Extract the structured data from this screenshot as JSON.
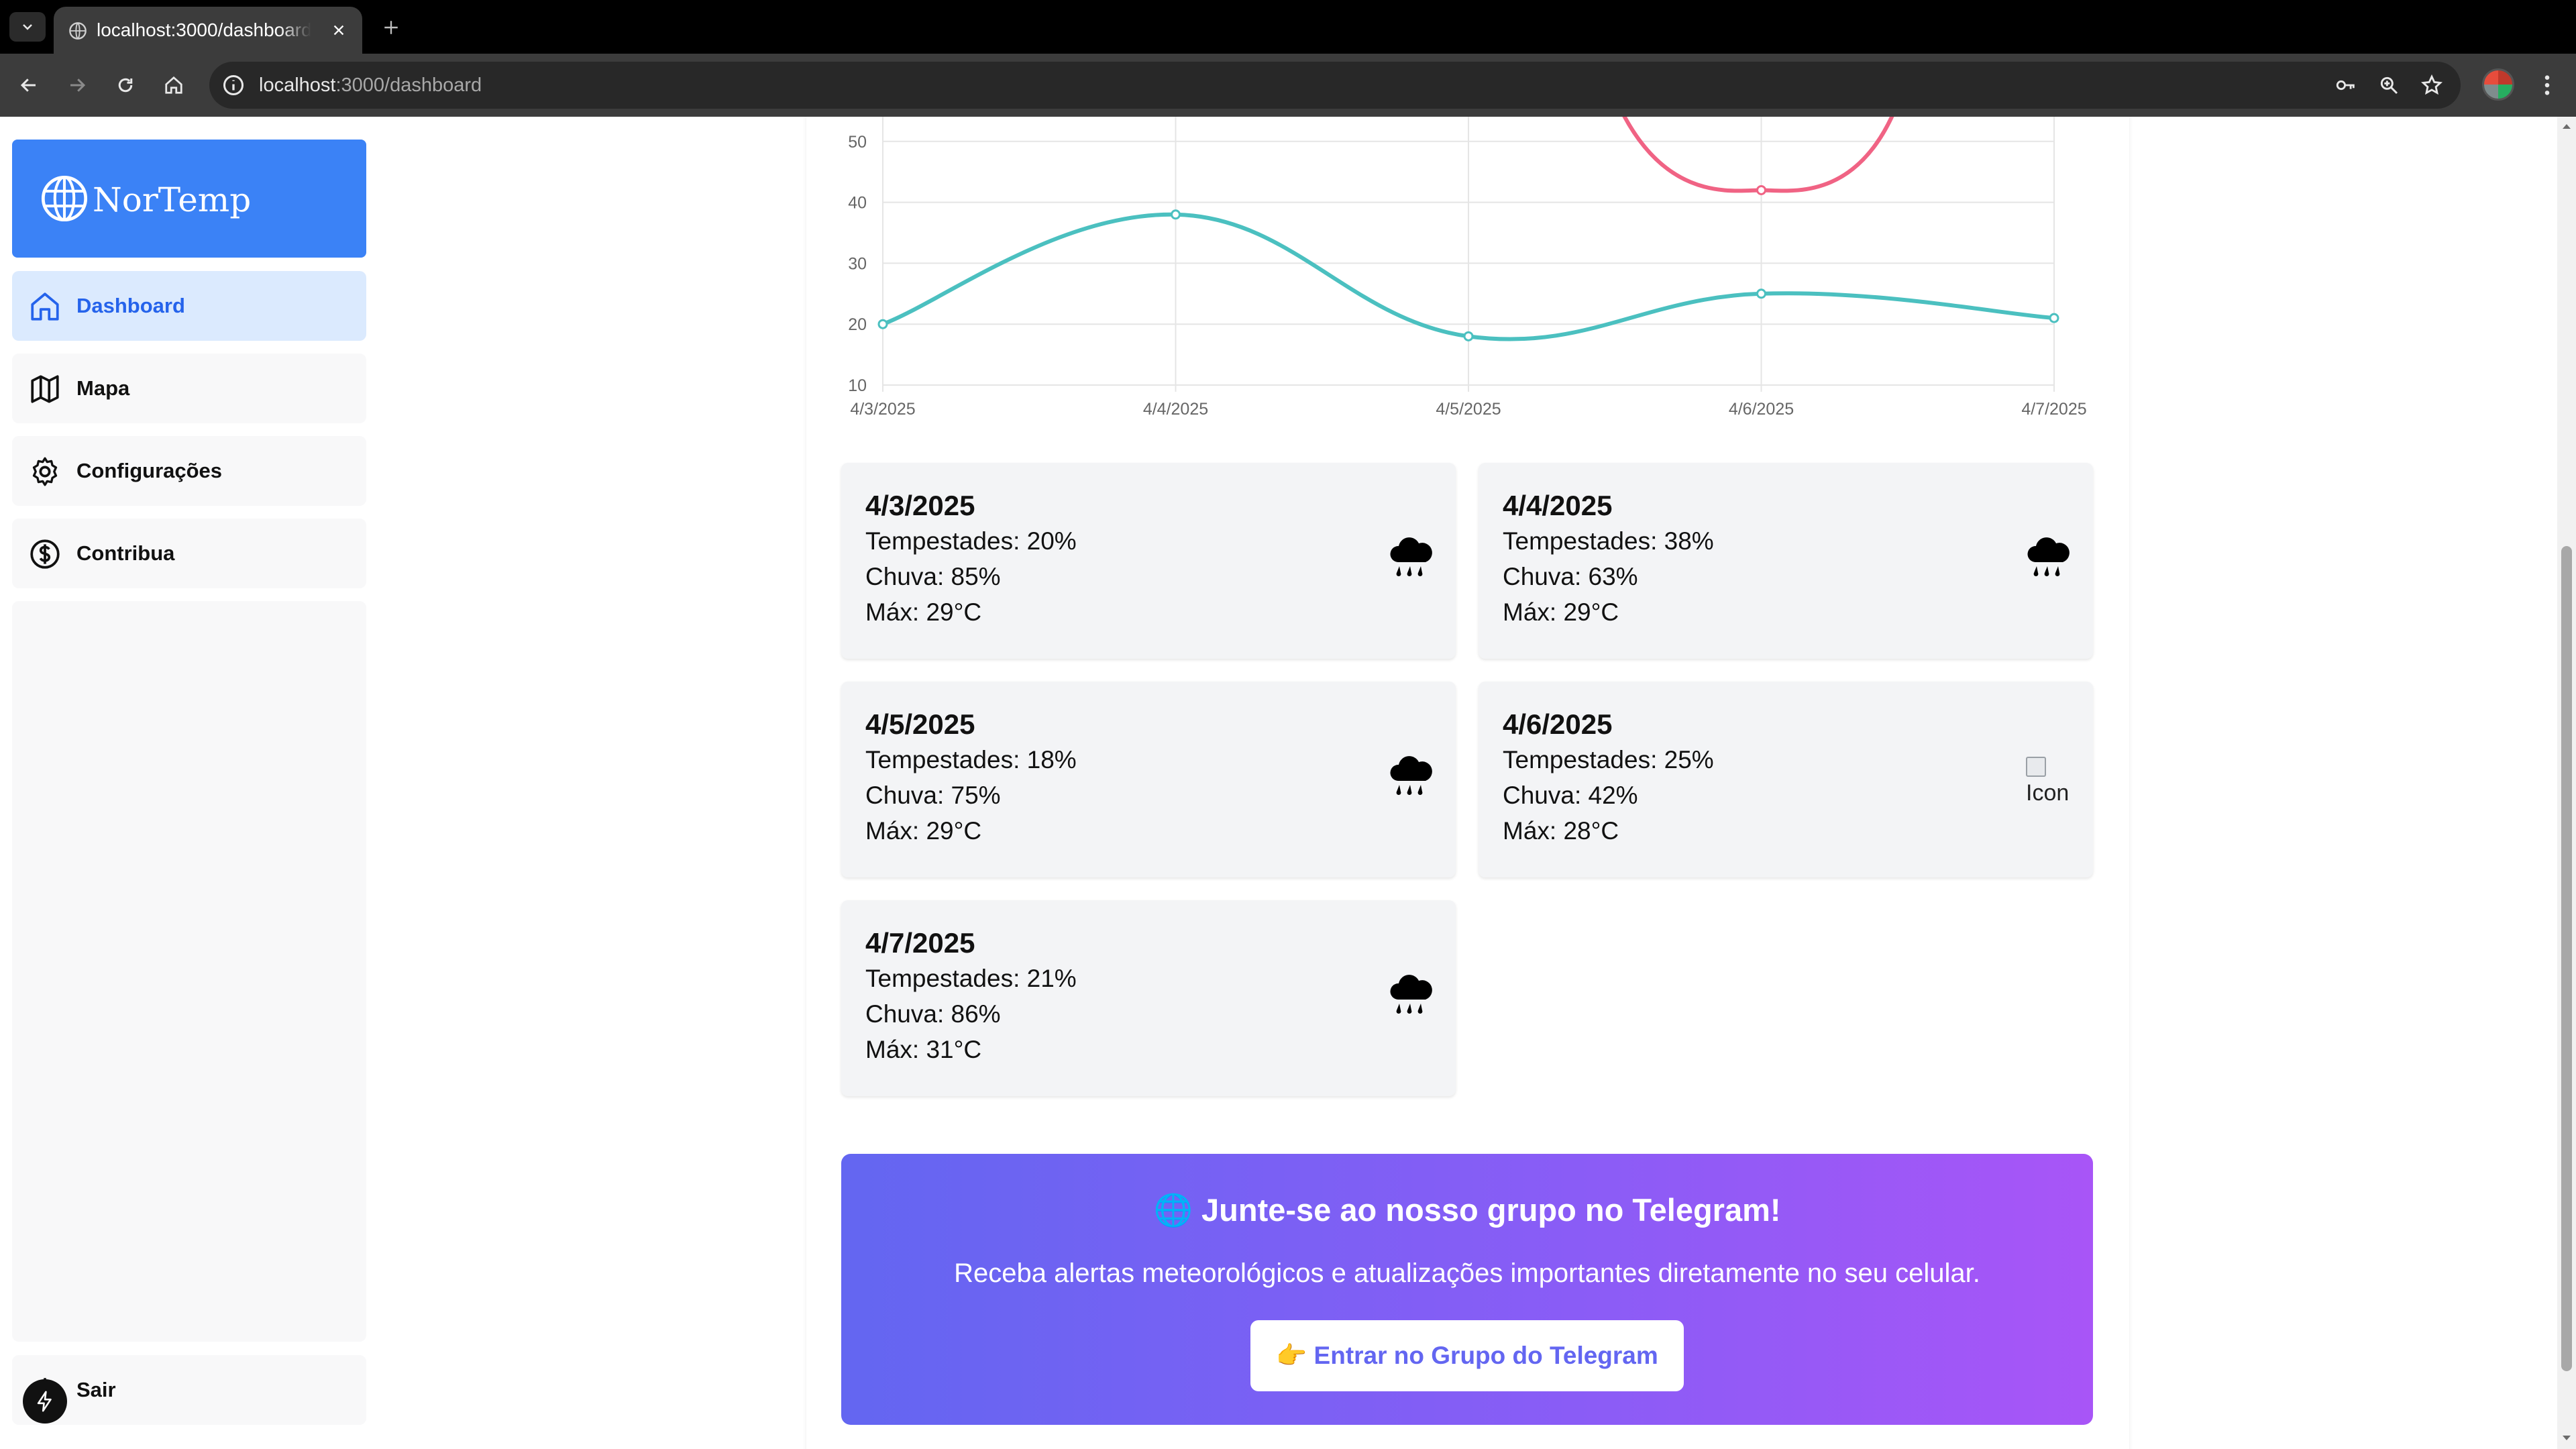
{
  "browser": {
    "tab_title": "localhost:3000/dashboard",
    "url_host": "localhost",
    "url_path": ":3000/dashboard"
  },
  "sidebar": {
    "logo_text": "NorTemp",
    "items": [
      {
        "label": "Dashboard",
        "icon": "home-icon",
        "active": true
      },
      {
        "label": "Mapa",
        "icon": "map-icon",
        "active": false
      },
      {
        "label": "Configurações",
        "icon": "gear-icon",
        "active": false
      },
      {
        "label": "Contribua",
        "icon": "dollar-circle-icon",
        "active": false
      }
    ],
    "logout_label": "Sair"
  },
  "chart_data": {
    "type": "line",
    "x": [
      "4/3/2025",
      "4/4/2025",
      "4/5/2025",
      "4/6/2025",
      "4/7/2025"
    ],
    "y_ticks": [
      10,
      20,
      30,
      40,
      50
    ],
    "ylim": [
      10,
      54
    ],
    "grid": true,
    "series": [
      {
        "values": [
          20,
          38,
          18,
          25,
          21
        ],
        "color": "#4bc0c0"
      },
      {
        "values": [
          null,
          null,
          null,
          42,
          null
        ],
        "color": "#f06384"
      }
    ]
  },
  "forecast": {
    "labels": {
      "storms": "Tempestades:",
      "rain": "Chuva:",
      "max": "Máx:"
    },
    "days": [
      {
        "date": "4/3/2025",
        "storms": "Tempestades: 20%",
        "rain": "Chuva: 85%",
        "max": "Máx: 29°C",
        "icon": "rain-cloud-icon"
      },
      {
        "date": "4/4/2025",
        "storms": "Tempestades: 38%",
        "rain": "Chuva: 63%",
        "max": "Máx: 29°C",
        "icon": "rain-cloud-icon"
      },
      {
        "date": "4/5/2025",
        "storms": "Tempestades: 18%",
        "rain": "Chuva: 75%",
        "max": "Máx: 29°C",
        "icon": "rain-cloud-icon"
      },
      {
        "date": "4/6/2025",
        "storms": "Tempestades: 25%",
        "rain": "Chuva: 42%",
        "max": "Máx: 28°C",
        "icon": "broken-image-icon",
        "alt": "Icon"
      },
      {
        "date": "4/7/2025",
        "storms": "Tempestades: 21%",
        "rain": "Chuva: 86%",
        "max": "Máx: 31°C",
        "icon": "rain-cloud-icon"
      }
    ]
  },
  "telegram": {
    "title": "🌐 Junte-se ao nosso grupo no Telegram!",
    "subtitle": "Receba alertas meteorológicos e atualizações importantes diretamente no seu celular.",
    "button_label": "👉 Entrar no Grupo do Telegram"
  },
  "colors": {
    "accent": "#3b82f6",
    "active_bg": "#dbeafe",
    "series_teal": "#4bc0c0",
    "series_pink": "#f06384",
    "banner_from": "#6366f1",
    "banner_to": "#a855f7"
  }
}
